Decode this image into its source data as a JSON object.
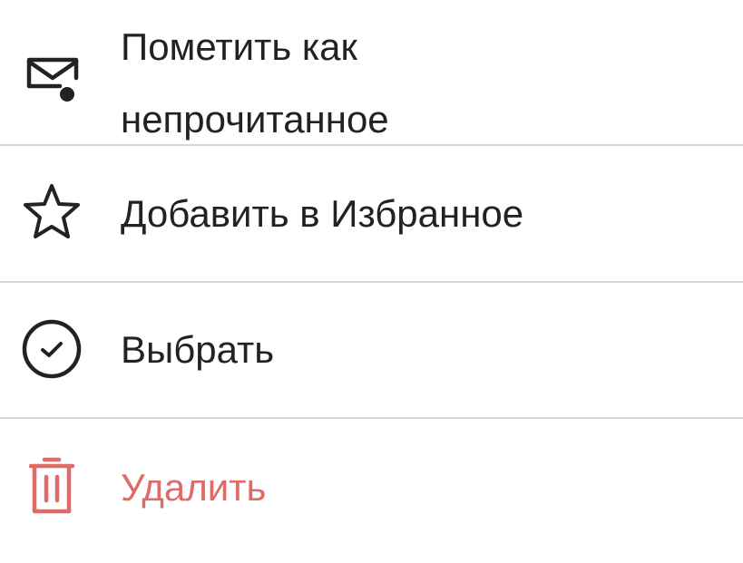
{
  "menu": {
    "items": [
      {
        "icon": "mail-unread-icon",
        "label": "Пометить как непрочитанное"
      },
      {
        "icon": "star-icon",
        "label": "Добавить в Избранное"
      },
      {
        "icon": "check-circle-icon",
        "label": "Выбрать"
      },
      {
        "icon": "trash-icon",
        "label": "Удалить"
      }
    ]
  },
  "colors": {
    "text": "#222222",
    "danger": "#df6b68",
    "divider": "#d6d6d6"
  }
}
